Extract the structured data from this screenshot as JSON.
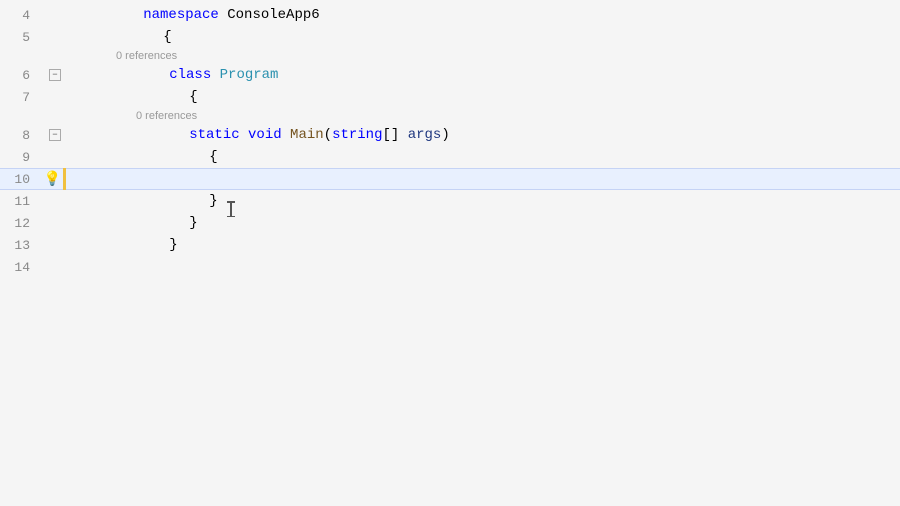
{
  "editor": {
    "background": "#f5f5f5",
    "lines": [
      {
        "number": "4",
        "type": "namespace",
        "hasCollapse": false,
        "hasLightbulb": false,
        "hasYellowBar": false,
        "highlighted": false,
        "hint": null,
        "segments": [
          {
            "text": "namespace ",
            "class": "kw-namespace"
          },
          {
            "text": "ConsoleApp6",
            "class": "ns-name"
          }
        ]
      },
      {
        "number": "5",
        "type": "code",
        "hasCollapse": false,
        "hasLightbulb": false,
        "hasYellowBar": false,
        "highlighted": false,
        "hint": null,
        "segments": [
          {
            "text": "    {",
            "class": "punctuation"
          }
        ]
      },
      {
        "number": "6",
        "type": "code",
        "hasCollapse": true,
        "hasLightbulb": false,
        "hasYellowBar": false,
        "highlighted": false,
        "hint": "0 references",
        "segments": [
          {
            "text": "        ",
            "class": ""
          },
          {
            "text": "class ",
            "class": "kw-class"
          },
          {
            "text": "Program",
            "class": "class-name"
          }
        ]
      },
      {
        "number": "7",
        "type": "code",
        "hasCollapse": false,
        "hasLightbulb": false,
        "hasYellowBar": false,
        "highlighted": false,
        "hint": null,
        "segments": [
          {
            "text": "        {",
            "class": "punctuation"
          }
        ]
      },
      {
        "number": "8",
        "type": "code",
        "hasCollapse": true,
        "hasLightbulb": false,
        "hasYellowBar": false,
        "highlighted": false,
        "hint": "0 references",
        "segments": [
          {
            "text": "            ",
            "class": ""
          },
          {
            "text": "static ",
            "class": "kw-static"
          },
          {
            "text": "void ",
            "class": "kw-void"
          },
          {
            "text": "Main",
            "class": "method-name"
          },
          {
            "text": "(",
            "class": "punctuation"
          },
          {
            "text": "string",
            "class": "kw-string"
          },
          {
            "text": "[] ",
            "class": "punctuation"
          },
          {
            "text": "args",
            "class": "param-name"
          },
          {
            "text": ")",
            "class": "punctuation"
          }
        ]
      },
      {
        "number": "9",
        "type": "code",
        "hasCollapse": false,
        "hasLightbulb": false,
        "hasYellowBar": false,
        "highlighted": false,
        "hint": null,
        "segments": [
          {
            "text": "            {",
            "class": "punctuation"
          }
        ]
      },
      {
        "number": "10",
        "type": "code",
        "hasCollapse": false,
        "hasLightbulb": true,
        "hasYellowBar": true,
        "highlighted": true,
        "hint": null,
        "segments": []
      },
      {
        "number": "11",
        "type": "code",
        "hasCollapse": false,
        "hasLightbulb": false,
        "hasYellowBar": false,
        "highlighted": false,
        "hint": null,
        "segments": [
          {
            "text": "            }",
            "class": "punctuation"
          }
        ]
      },
      {
        "number": "12",
        "type": "code",
        "hasCollapse": false,
        "hasLightbulb": false,
        "hasYellowBar": false,
        "highlighted": false,
        "hint": null,
        "segments": [
          {
            "text": "        }",
            "class": "punctuation"
          }
        ]
      },
      {
        "number": "13",
        "type": "code",
        "hasCollapse": false,
        "hasLightbulb": false,
        "hasYellowBar": false,
        "highlighted": false,
        "hint": null,
        "segments": [
          {
            "text": "    }",
            "class": "punctuation"
          }
        ]
      },
      {
        "number": "14",
        "type": "empty",
        "hasCollapse": false,
        "hasLightbulb": false,
        "hasYellowBar": false,
        "highlighted": false,
        "hint": null,
        "segments": []
      }
    ]
  }
}
